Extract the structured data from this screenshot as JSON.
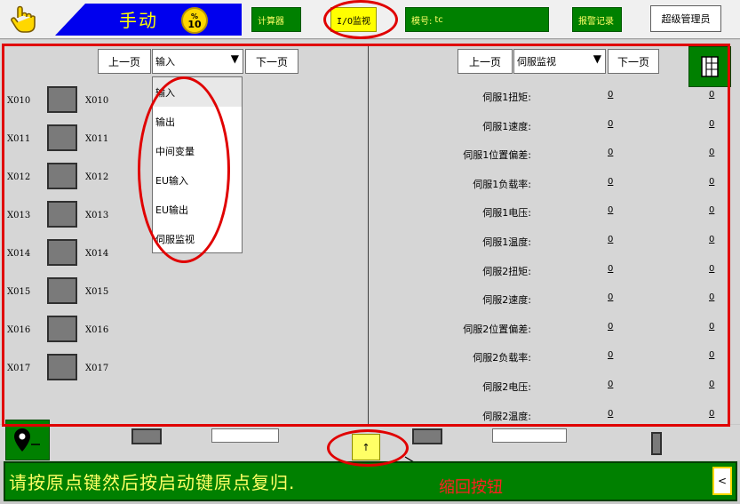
{
  "topbar": {
    "mode_label": "手动",
    "speed_unit": "%",
    "speed_value": "10",
    "calculator_label": "计算器",
    "io_monitor_label": "I/O监视",
    "model_label": "模号:",
    "model_value": "tc",
    "alarm_log_label": "报警记录",
    "user_label": "超级管理员"
  },
  "left_panel": {
    "prev_label": "上一页",
    "select_value": "输入",
    "next_label": "下一页",
    "dropdown_options": [
      "输入",
      "输出",
      "中间变量",
      "EU输入",
      "EU输出",
      "伺服监视"
    ],
    "rows": [
      {
        "name": "X010",
        "desc": "X010"
      },
      {
        "name": "X011",
        "desc": "X011"
      },
      {
        "name": "X012",
        "desc": "X012"
      },
      {
        "name": "X013",
        "desc": "X013"
      },
      {
        "name": "X014",
        "desc": "X014"
      },
      {
        "name": "X015",
        "desc": "X015"
      },
      {
        "name": "X016",
        "desc": "X016"
      },
      {
        "name": "X017",
        "desc": "X017"
      }
    ]
  },
  "right_panel": {
    "prev_label": "上一页",
    "select_value": "伺服监视",
    "next_label": "下一页",
    "rows": [
      {
        "label": "伺服1扭矩:",
        "v1": "0",
        "v2": "0"
      },
      {
        "label": "伺服1速度:",
        "v1": "0",
        "v2": "0"
      },
      {
        "label": "伺服1位置偏差:",
        "v1": "0",
        "v2": "0"
      },
      {
        "label": "伺服1负载率:",
        "v1": "0",
        "v2": "0"
      },
      {
        "label": "伺服1电压:",
        "v1": "0",
        "v2": "0"
      },
      {
        "label": "伺服1温度:",
        "v1": "0",
        "v2": "0"
      },
      {
        "label": "伺服2扭矩:",
        "v1": "0",
        "v2": "0"
      },
      {
        "label": "伺服2速度:",
        "v1": "0",
        "v2": "0"
      },
      {
        "label": "伺服2位置偏差:",
        "v1": "0",
        "v2": "0"
      },
      {
        "label": "伺服2负载率:",
        "v1": "0",
        "v2": "0"
      },
      {
        "label": "伺服2电压:",
        "v1": "0",
        "v2": "0"
      },
      {
        "label": "伺服2温度:",
        "v1": "0",
        "v2": "0"
      }
    ]
  },
  "bottom": {
    "up_arrow": "↑"
  },
  "status": {
    "message": "请按原点键然后按启动键原点复归.",
    "collapse_glyph": "<"
  },
  "annotation": {
    "collapse_note": "缩回按钮"
  },
  "colors": {
    "accent_green": "#008000",
    "accent_yellow": "#ffff00",
    "annotation_red": "#e00000",
    "mode_blue": "#0000ee"
  }
}
